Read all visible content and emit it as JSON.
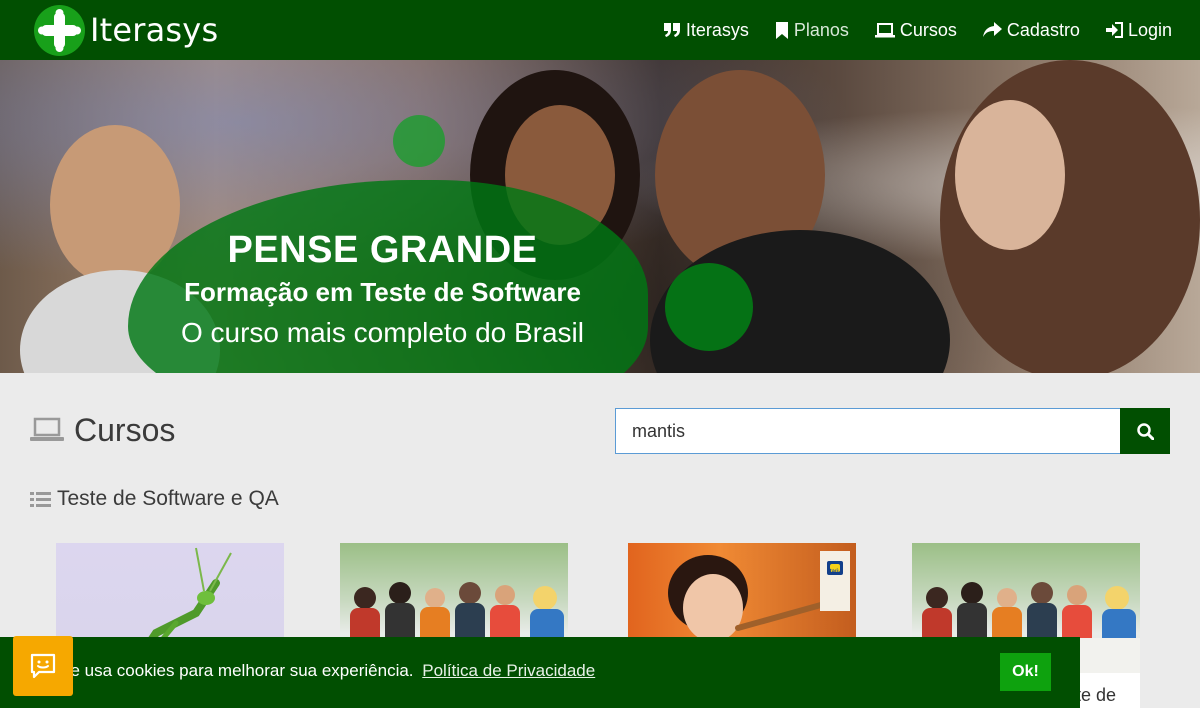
{
  "navbar": {
    "brand": "Iterasys",
    "items": [
      {
        "label": "Iterasys",
        "icon": "quote-icon"
      },
      {
        "label": "Planos",
        "icon": "bookmark-icon"
      },
      {
        "label": "Cursos",
        "icon": "laptop-icon"
      },
      {
        "label": "Cadastro",
        "icon": "share-icon"
      },
      {
        "label": "Login",
        "icon": "sign-in-icon"
      }
    ]
  },
  "hero": {
    "title": "PENSE GRANDE",
    "subtitle": "Formação em Teste de Software",
    "tagline": "O curso mais completo do Brasil"
  },
  "main": {
    "section_title": "Cursos",
    "search": {
      "value": "mantis"
    },
    "category": "Teste de Software e QA",
    "cards": [
      {
        "image": "mantis-photo"
      },
      {
        "image": "team-meeting-photo"
      },
      {
        "image": "woman-drinking-photo",
        "badge": "Itaú"
      },
      {
        "image": "team-meeting-photo",
        "text": "te de"
      }
    ]
  },
  "cookie": {
    "text": "ite usa cookies para melhorar sua experiência.",
    "link": "Política de Privacidade",
    "ok": "Ok!"
  },
  "colors": {
    "primary": "#014f01",
    "accent": "#18a01a",
    "ok_button": "#0ea20e",
    "chat_button": "#f6a800"
  }
}
